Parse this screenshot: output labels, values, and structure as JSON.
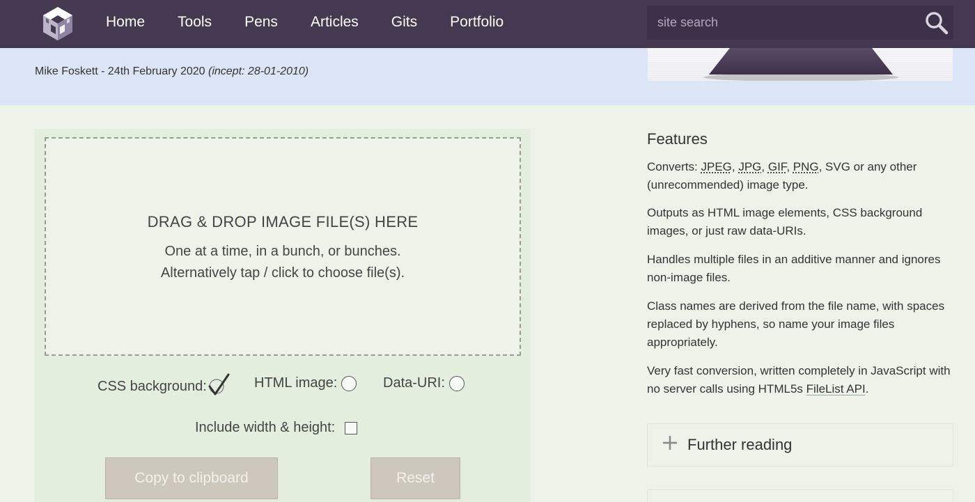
{
  "nav": {
    "logo_name": "cube-logo",
    "links": [
      "Home",
      "Tools",
      "Pens",
      "Articles",
      "Gits",
      "Portfolio"
    ],
    "search": {
      "placeholder": "site search",
      "value": ""
    }
  },
  "byline": {
    "author_date": "Mike Foskett - 24th February 2020 ",
    "incept": "(incept: 28-01-2010)"
  },
  "tool": {
    "dropzone": {
      "title": "DRAG & DROP IMAGE FILE(S) HERE",
      "line1": "One at a time, in a bunch, or bunches.",
      "line2": "Alternatively tap / click to choose file(s)."
    },
    "options": {
      "css_label": "CSS background:",
      "html_label": "HTML image:",
      "datauri_label": "Data-URI:",
      "selected": "CSS background"
    },
    "include_label": "Include width & height:",
    "include_checked": false,
    "copy_label": "Copy to clipboard",
    "reset_label": "Reset"
  },
  "sidebar": {
    "title": "Features",
    "p1": {
      "prefix": "Converts: ",
      "jpeg": "JPEG",
      "sep1": ", ",
      "jpg": "JPG",
      "sep2": ", ",
      "gif": "GIF",
      "sep3": ", ",
      "png": "PNG",
      "rest": ", SVG or any other (unrecommended) image type."
    },
    "p2": "Outputs as HTML image elements, CSS background images, or just raw data-URIs.",
    "p3": "Handles multiple files in an additive manner and ignores non-image files.",
    "p4": "Class names are derived from the file name, with spaces replaced by hyphens, so name your image files appropriately.",
    "p5": {
      "text": "Very fast conversion, written completely in JavaScript with no server calls using HTML5s ",
      "link": "FileList API",
      "end": "."
    },
    "further_reading": "Further reading"
  },
  "colors": {
    "nav_bg": "#453952",
    "band_bg": "#dce5f5",
    "panel_bg": "#e3eedf",
    "page_bg": "#eef3ea",
    "button_bg": "#cdc7bd"
  }
}
